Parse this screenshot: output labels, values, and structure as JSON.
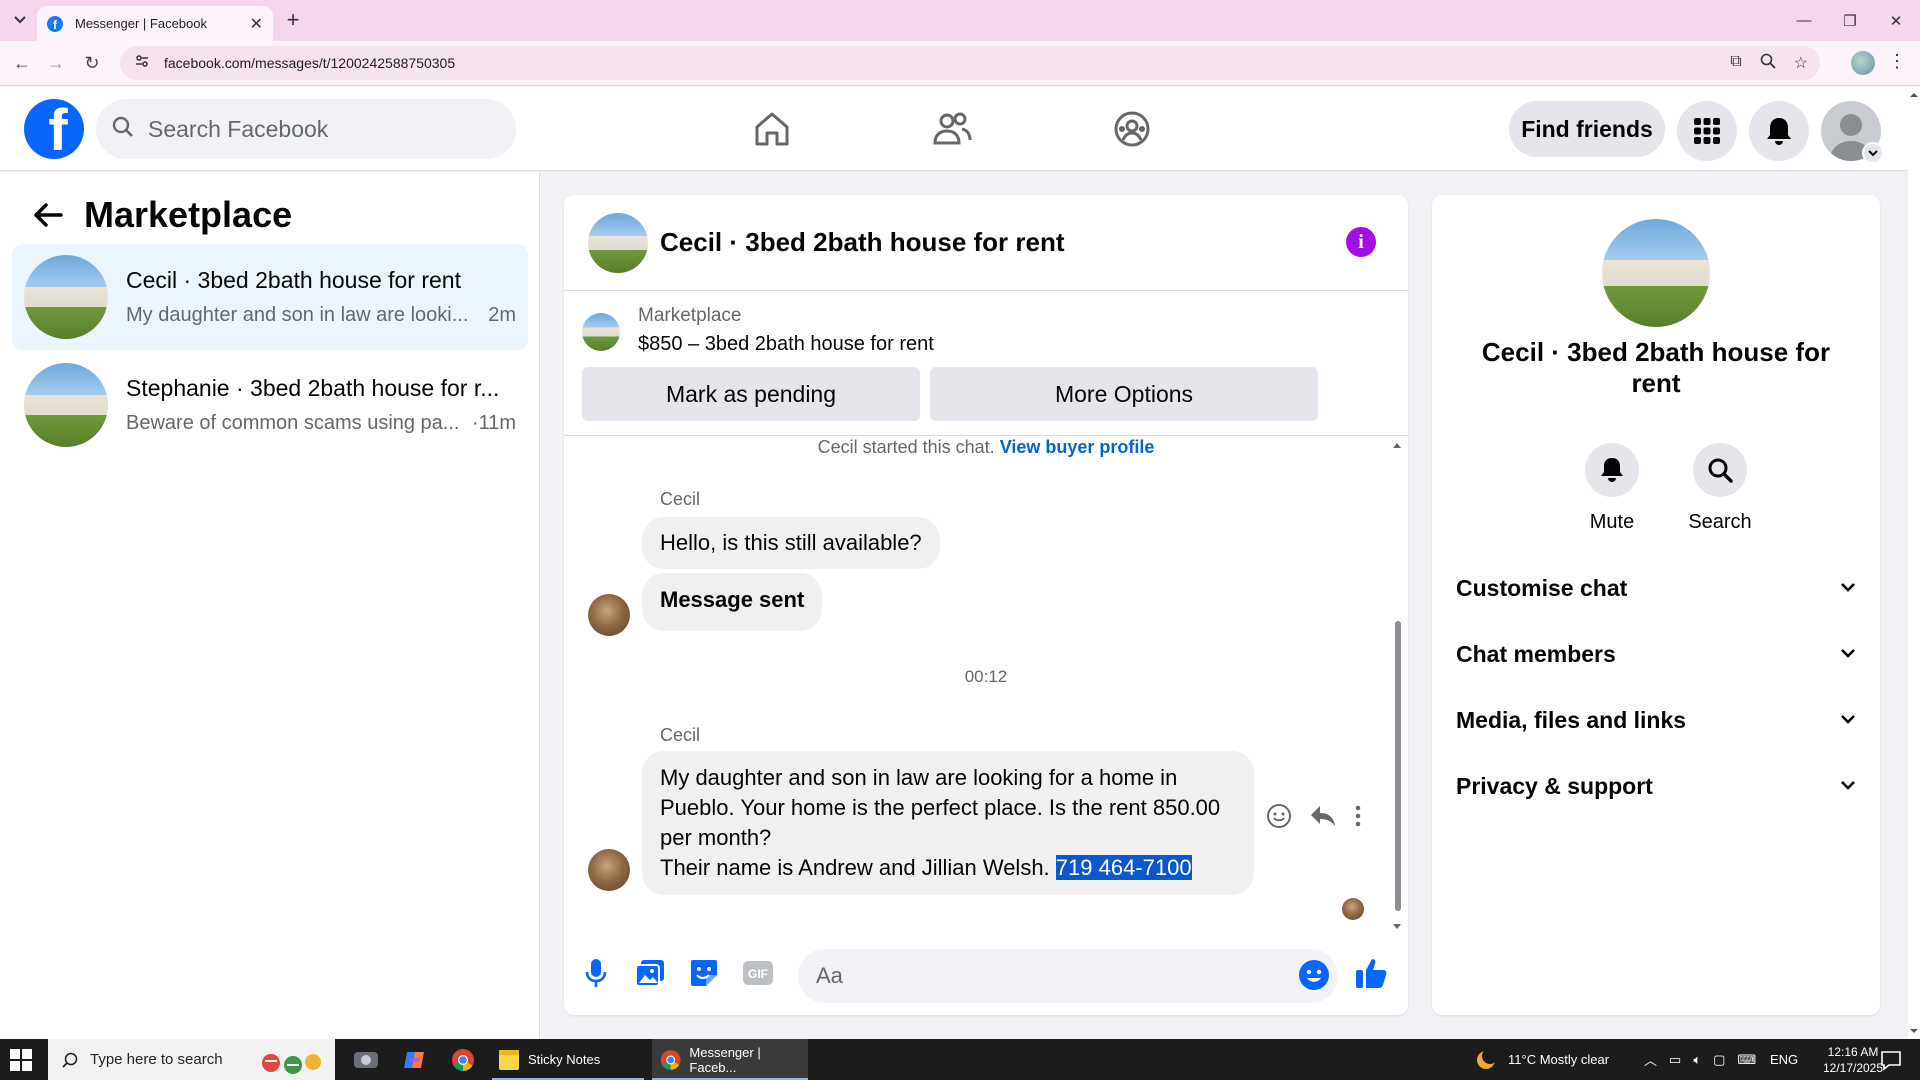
{
  "browser": {
    "tab_title": "Messenger | Facebook",
    "url": "facebook.com/messages/t/1200242588750305"
  },
  "fb": {
    "search_placeholder": "Search Facebook",
    "find_friends": "Find friends"
  },
  "left": {
    "title": "Marketplace",
    "conversations": [
      {
        "title": "Cecil · 3bed 2bath house for rent",
        "snippet": "My daughter and son in law are looki...",
        "time": "2m"
      },
      {
        "title": "Stephanie · 3bed 2bath house for r...",
        "snippet": "Beware of common scams using pa...",
        "time": "·11m"
      }
    ]
  },
  "chat": {
    "title": "Cecil · 3bed 2bath house for rent",
    "listing_source": "Marketplace",
    "listing_title": "$850 – 3bed 2bath house for rent",
    "btn_pending": "Mark as pending",
    "btn_more": "More Options",
    "started_text": "Cecil started this chat.",
    "started_link": "View buyer profile",
    "sender1": "Cecil",
    "msg1": "Hello, is this still available?",
    "msg2": "Message sent",
    "timestamp": "00:12",
    "sender2": "Cecil",
    "msg3_line1": "My daughter and son in law are looking for a home in",
    "msg3_line2": "Pueblo. Your home is the perfect place. Is the rent 850.00",
    "msg3_line3": "per month?",
    "msg3_line4": "Their name is Andrew and Jillian  Welsh.",
    "msg3_phone": "719 464-7100",
    "composer_placeholder": "Aa"
  },
  "right": {
    "name": "Cecil · 3bed 2bath house for rent",
    "mute": "Mute",
    "search": "Search",
    "sections": [
      "Customise chat",
      "Chat members",
      "Media, files and links",
      "Privacy & support"
    ]
  },
  "taskbar": {
    "search_placeholder": "Type here to search",
    "sticky": "Sticky Notes",
    "messenger": "Messenger | Faceb...",
    "weather": "11°C  Mostly clear",
    "lang": "ENG",
    "time": "12:16 AM",
    "date": "12/17/2025"
  },
  "colors": {
    "fb_blue": "#0866ff",
    "link_blue": "#0064d1",
    "info_purple": "#a20ee3",
    "selection": "#0b57d0"
  }
}
